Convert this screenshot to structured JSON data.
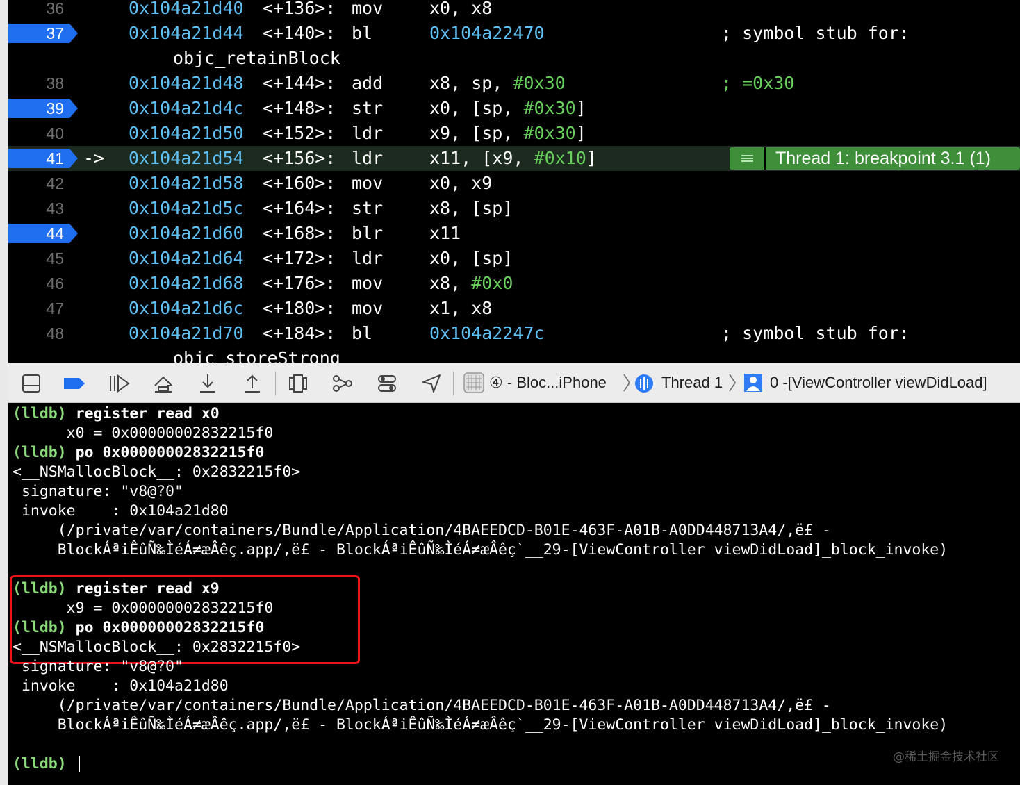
{
  "editor": {
    "rows": [
      {
        "line": "36",
        "addr": "0x104a21d40",
        "off": "<+136>:",
        "op": "mov",
        "args": [
          {
            "t": "x0, x8",
            "c": "plain"
          }
        ],
        "comment": "",
        "cont": ""
      },
      {
        "line": "37",
        "addr": "0x104a21d44",
        "off": "<+140>:",
        "op": "bl",
        "args": [
          {
            "t": "0x104a22470",
            "c": "ref"
          }
        ],
        "comment": "; symbol stub for:",
        "cont": ""
      },
      {
        "line": "",
        "addr": "",
        "off": "",
        "op": "",
        "args": [],
        "comment": "",
        "cont": "objc_retainBlock"
      },
      {
        "line": "38",
        "addr": "0x104a21d48",
        "off": "<+144>:",
        "op": "add",
        "args": [
          {
            "t": "x8, sp, ",
            "c": "plain"
          },
          {
            "t": "#0x30",
            "c": "imm"
          }
        ],
        "comment": "; =0x30",
        "cont": ""
      },
      {
        "line": "39",
        "addr": "0x104a21d4c",
        "off": "<+148>:",
        "op": "str",
        "args": [
          {
            "t": "x0, [sp, ",
            "c": "plain"
          },
          {
            "t": "#0x30",
            "c": "imm"
          },
          {
            "t": "]",
            "c": "plain"
          }
        ],
        "comment": "",
        "cont": ""
      },
      {
        "line": "40",
        "addr": "0x104a21d50",
        "off": "<+152>:",
        "op": "ldr",
        "args": [
          {
            "t": "x9, [sp, ",
            "c": "plain"
          },
          {
            "t": "#0x30",
            "c": "imm"
          },
          {
            "t": "]",
            "c": "plain"
          }
        ],
        "comment": "",
        "cont": ""
      },
      {
        "line": "41",
        "addr": "0x104a21d54",
        "off": "<+156>:",
        "op": "ldr",
        "args": [
          {
            "t": "x11, [x9, ",
            "c": "plain"
          },
          {
            "t": "#0x10",
            "c": "imm"
          },
          {
            "t": "]",
            "c": "plain"
          }
        ],
        "comment": "",
        "cont": "",
        "arrow": "->",
        "badge": "Thread 1: breakpoint 3.1 (1)"
      },
      {
        "line": "42",
        "addr": "0x104a21d58",
        "off": "<+160>:",
        "op": "mov",
        "args": [
          {
            "t": "x0, x9",
            "c": "plain"
          }
        ],
        "comment": "",
        "cont": ""
      },
      {
        "line": "43",
        "addr": "0x104a21d5c",
        "off": "<+164>:",
        "op": "str",
        "args": [
          {
            "t": "x8, [sp]",
            "c": "plain"
          }
        ],
        "comment": "",
        "cont": ""
      },
      {
        "line": "44",
        "addr": "0x104a21d60",
        "off": "<+168>:",
        "op": "blr",
        "args": [
          {
            "t": "x11",
            "c": "plain"
          }
        ],
        "comment": "",
        "cont": ""
      },
      {
        "line": "45",
        "addr": "0x104a21d64",
        "off": "<+172>:",
        "op": "ldr",
        "args": [
          {
            "t": "x0, [sp]",
            "c": "plain"
          }
        ],
        "comment": "",
        "cont": ""
      },
      {
        "line": "46",
        "addr": "0x104a21d68",
        "off": "<+176>:",
        "op": "mov",
        "args": [
          {
            "t": "x8, ",
            "c": "plain"
          },
          {
            "t": "#0x0",
            "c": "imm"
          }
        ],
        "comment": "",
        "cont": ""
      },
      {
        "line": "47",
        "addr": "0x104a21d6c",
        "off": "<+180>:",
        "op": "mov",
        "args": [
          {
            "t": "x1, x8",
            "c": "plain"
          }
        ],
        "comment": "",
        "cont": ""
      },
      {
        "line": "48",
        "addr": "0x104a21d70",
        "off": "<+184>:",
        "op": "bl",
        "args": [
          {
            "t": "0x104a2247c",
            "c": "ref"
          }
        ],
        "comment": "; symbol stub for:",
        "cont": ""
      },
      {
        "line": "",
        "addr": "",
        "off": "",
        "op": "",
        "args": [],
        "comment": "",
        "cont": "objc_storeStrong"
      }
    ],
    "breakpoint_lines": [
      "37",
      "39",
      "41",
      "44"
    ],
    "current_line": "41",
    "colors": {
      "address": "#5ec0f4",
      "immediate": "#67d05a",
      "breakpoint": "#1f6ff0",
      "badge": "#3f8f3a"
    }
  },
  "toolbar": {
    "buttons": [
      {
        "name": "hide-debug-area-button",
        "icon": "panel-icon"
      },
      {
        "name": "breakpoints-toggle-button",
        "icon": "breakpoint-icon"
      },
      {
        "name": "continue-button",
        "icon": "continue-icon"
      },
      {
        "name": "step-over-button",
        "icon": "step-over-icon"
      },
      {
        "name": "step-into-button",
        "icon": "step-into-icon"
      },
      {
        "name": "step-out-button",
        "icon": "step-out-icon"
      },
      {
        "name": "view-hierarchy-button",
        "icon": "view-hierarchy-icon"
      },
      {
        "name": "memory-graph-button",
        "icon": "memory-graph-icon"
      },
      {
        "name": "environment-overrides-button",
        "icon": "environment-overrides-icon"
      },
      {
        "name": "simulate-location-button",
        "icon": "location-icon"
      }
    ],
    "breadcrumb": {
      "process": "④ - Bloc...iPhone",
      "thread": "Thread 1",
      "frame": "0 -[ViewController viewDidLoad]"
    }
  },
  "console": {
    "lines": [
      {
        "prompt": "(lldb)",
        "cmd": "register read x0",
        "text": ""
      },
      {
        "prompt": "",
        "cmd": "",
        "text": "      x0 = 0x00000002832215f0"
      },
      {
        "prompt": "(lldb)",
        "cmd": "po 0x00000002832215f0",
        "text": ""
      },
      {
        "prompt": "",
        "cmd": "",
        "text": "<__NSMallocBlock__: 0x2832215f0>"
      },
      {
        "prompt": "",
        "cmd": "",
        "text": " signature: \"v8@?0\""
      },
      {
        "prompt": "",
        "cmd": "",
        "text": " invoke    : 0x104a21d80"
      },
      {
        "prompt": "",
        "cmd": "",
        "text": "     (/private/var/containers/Bundle/Application/4BAEEDCD-B01E-463F-A01B-A0DD448713A4/,ë£ -"
      },
      {
        "prompt": "",
        "cmd": "",
        "text": "     BlockÁªiÊûÑ‰ÌéÁ≠æÂêç.app/,ë£ - BlockÁªiÊûÑ‰ÌéÁ≠æÂêç`__29-[ViewController viewDidLoad]_block_invoke)"
      },
      {
        "prompt": "",
        "cmd": "",
        "text": ""
      },
      {
        "prompt": "(lldb)",
        "cmd": "register read x9",
        "text": ""
      },
      {
        "prompt": "",
        "cmd": "",
        "text": "      x9 = 0x00000002832215f0"
      },
      {
        "prompt": "(lldb)",
        "cmd": "po 0x00000002832215f0",
        "text": ""
      },
      {
        "prompt": "",
        "cmd": "",
        "text": "<__NSMallocBlock__: 0x2832215f0>"
      },
      {
        "prompt": "",
        "cmd": "",
        "text": " signature: \"v8@?0\""
      },
      {
        "prompt": "",
        "cmd": "",
        "text": " invoke    : 0x104a21d80"
      },
      {
        "prompt": "",
        "cmd": "",
        "text": "     (/private/var/containers/Bundle/Application/4BAEEDCD-B01E-463F-A01B-A0DD448713A4/,ë£ -"
      },
      {
        "prompt": "",
        "cmd": "",
        "text": "     BlockÁªiÊûÑ‰ÌéÁ≠æÂêç.app/,ë£ - BlockÁªiÊûÑ‰ÌéÁ≠æÂêç`__29-[ViewController viewDidLoad]_block_invoke)"
      },
      {
        "prompt": "",
        "cmd": "",
        "text": ""
      },
      {
        "prompt": "(lldb)",
        "cmd": "",
        "text": "",
        "cursor": true
      }
    ],
    "highlight_color": "#e8141a",
    "watermark": "@稀土掘金技术社区"
  }
}
